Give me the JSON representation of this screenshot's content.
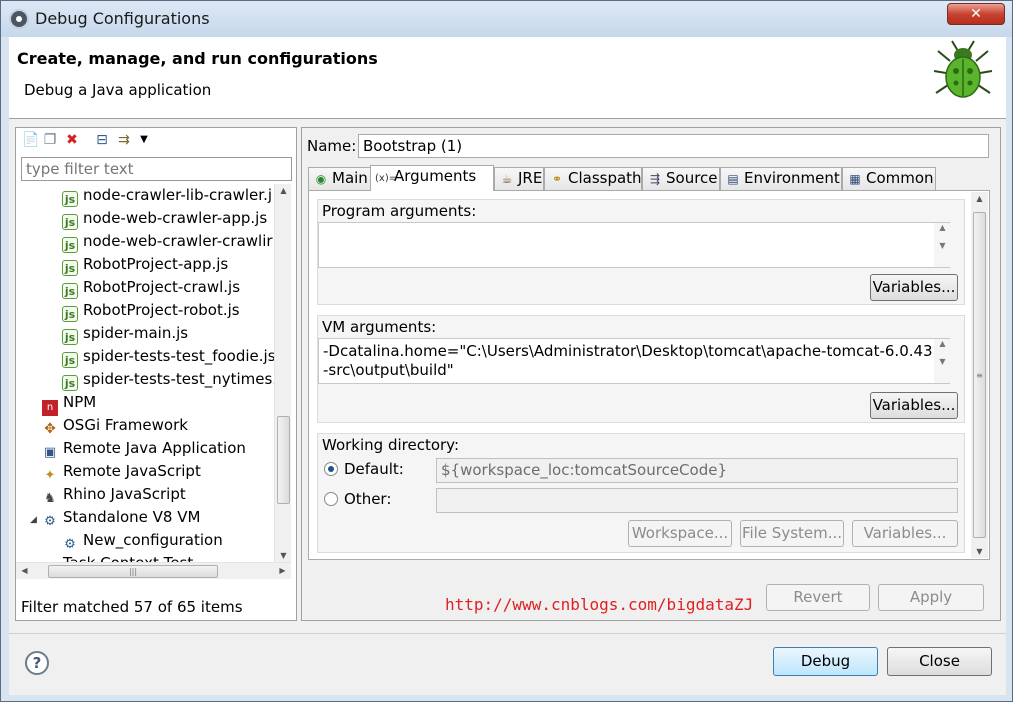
{
  "window": {
    "title": "Debug Configurations",
    "close_label": "✕"
  },
  "header": {
    "title": "Create, manage, and run configurations",
    "subtitle": "Debug a Java application"
  },
  "left": {
    "filter_placeholder": "type filter text",
    "tree": [
      {
        "label": "node-crawler-lib-crawler.j",
        "icon": "node-icon"
      },
      {
        "label": "node-web-crawler-app.js",
        "icon": "node-icon"
      },
      {
        "label": "node-web-crawler-crawlir",
        "icon": "node-icon"
      },
      {
        "label": "RobotProject-app.js",
        "icon": "node-icon"
      },
      {
        "label": "RobotProject-crawl.js",
        "icon": "node-icon"
      },
      {
        "label": "RobotProject-robot.js",
        "icon": "node-icon"
      },
      {
        "label": "spider-main.js",
        "icon": "node-icon"
      },
      {
        "label": "spider-tests-test_foodie.js",
        "icon": "node-icon"
      },
      {
        "label": "spider-tests-test_nytimes.",
        "icon": "node-icon"
      },
      {
        "label": "NPM",
        "icon": "npm-icon"
      },
      {
        "label": "OSGi Framework",
        "icon": "osgi-icon"
      },
      {
        "label": "Remote Java Application",
        "icon": "remote-java-icon"
      },
      {
        "label": "Remote JavaScript",
        "icon": "remote-javascript-icon"
      },
      {
        "label": "Rhino JavaScript",
        "icon": "rhino-icon"
      },
      {
        "label": "Standalone V8 VM",
        "icon": "v8-icon"
      },
      {
        "label": "New_configuration",
        "icon": "v8-icon"
      },
      {
        "label": "Task Context Test",
        "icon": "task-icon"
      }
    ],
    "status": "Filter matched 57 of 65 items"
  },
  "right": {
    "name_label": "Name:",
    "name_value": "Bootstrap (1)",
    "tabs": [
      {
        "label": "Main",
        "icon": "main-icon"
      },
      {
        "label": "Arguments",
        "icon": "arguments-icon"
      },
      {
        "label": "JRE",
        "icon": "jre-icon"
      },
      {
        "label": "Classpath",
        "icon": "classpath-icon"
      },
      {
        "label": "Source",
        "icon": "source-icon"
      },
      {
        "label": "Environment",
        "icon": "environment-icon"
      },
      {
        "label": "Common",
        "icon": "common-icon"
      }
    ],
    "program_args": {
      "title": "Program arguments:",
      "value": "",
      "variables_label": "Variables..."
    },
    "vm_args": {
      "title": "VM arguments:",
      "value": "-Dcatalina.home=\"C:\\Users\\Administrator\\Desktop\\tomcat\\apache-tomcat-6.0.43\n-src\\output\\build\"",
      "variables_label": "Variables..."
    },
    "working_dir": {
      "title": "Working directory:",
      "default_label": "Default:",
      "default_value": "${workspace_loc:tomcatSourceCode}",
      "other_label": "Other:",
      "other_value": "",
      "workspace_label": "Workspace...",
      "filesystem_label": "File System...",
      "variables_label": "Variables..."
    },
    "revert_label": "Revert",
    "apply_label": "Apply"
  },
  "footer": {
    "debug_label": "Debug",
    "close_label": "Close",
    "help_label": "?"
  },
  "watermark": "http://www.cnblogs.com/bigdataZJ"
}
